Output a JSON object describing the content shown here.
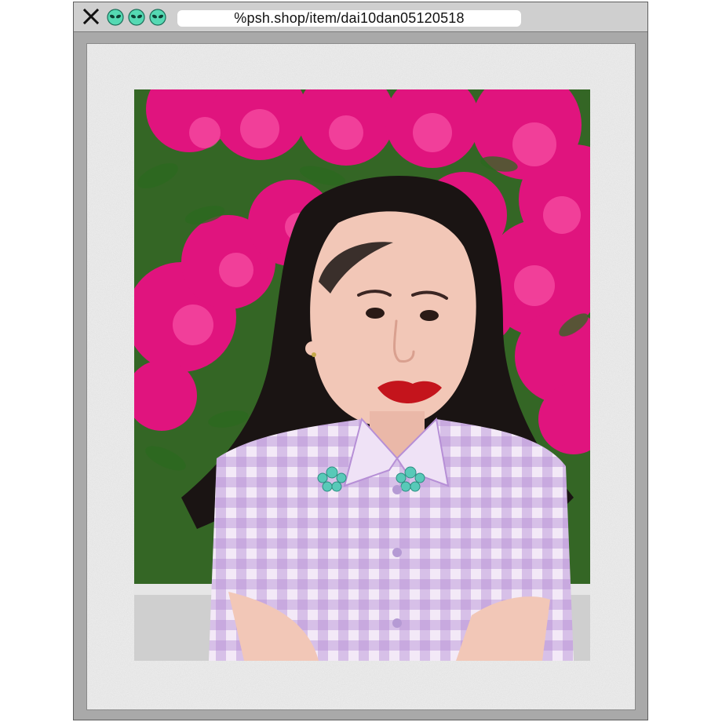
{
  "browser": {
    "url": "%psh.shop/item/dai10dan05120518",
    "icons": {
      "close": "close-icon",
      "tabs": [
        "alien-icon",
        "alien-icon",
        "alien-icon"
      ]
    }
  },
  "photo": {
    "subject": "portrait-photo",
    "colors": {
      "flowers": "#e0147e",
      "leaves": "#3f7f2a",
      "shirt_base": "#e7d2ef",
      "shirt_check": "#b68fd6",
      "embroidery": "#58c9b8",
      "lips": "#c4141c"
    }
  }
}
